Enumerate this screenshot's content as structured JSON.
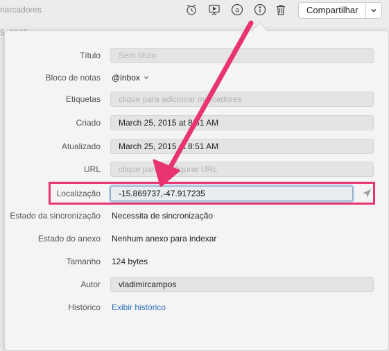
{
  "background": {
    "top_text": "narcadores",
    "side_text": "5, 2015"
  },
  "toolbar": {
    "icons": [
      "alarm-clock-icon",
      "presentation-icon",
      "at-sign-icon",
      "info-icon",
      "trash-icon"
    ],
    "share_label": "Compartilhar"
  },
  "info_panel": {
    "titulo": {
      "label": "Título",
      "placeholder": "Sem título"
    },
    "bloco": {
      "label": "Bloco de notas",
      "value": "@inbox"
    },
    "etiquetas": {
      "label": "Etiquetas",
      "placeholder": "clique para adicionar marcadores"
    },
    "criado": {
      "label": "Criado",
      "value": "March 25, 2015 at 8:51 AM"
    },
    "atualizado": {
      "label": "Atualizado",
      "value": "March 25, 2015 at 8:51 AM"
    },
    "url": {
      "label": "URL",
      "placeholder": "clique para configurar URL"
    },
    "localizacao": {
      "label": "Localização",
      "value": "-15.869737,-47.917235"
    },
    "estado_sync": {
      "label": "Estado da sincronização",
      "value": "Necessita de sincronização"
    },
    "estado_anexo": {
      "label": "Estado do anexo",
      "value": "Nenhum anexo para indexar"
    },
    "tamanho": {
      "label": "Tamanho",
      "value": "124 bytes"
    },
    "autor": {
      "label": "Autor",
      "value": "vladimircampos"
    },
    "historico": {
      "label": "Histórico",
      "link": "Exibir histórico"
    }
  },
  "colors": {
    "annotation": "#e8346f",
    "link": "#2d6fbf",
    "focus_ring": "#b7ccea"
  }
}
